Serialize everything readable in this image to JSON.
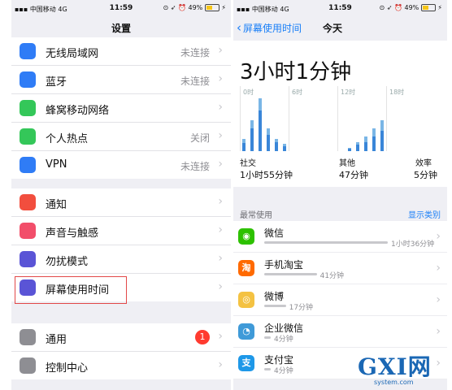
{
  "left_screen": {
    "status": {
      "carrier": "中国移动",
      "network": "4G",
      "time": "11:59",
      "battery": "49%"
    },
    "title": "设置",
    "group1": [
      {
        "icon": "wifi-icon",
        "label": "无线局域网",
        "value": "未连接",
        "color": "#2f7cf6"
      },
      {
        "icon": "bluetooth-icon",
        "label": "蓝牙",
        "value": "未连接",
        "color": "#2f7cf6"
      },
      {
        "icon": "cellular-icon",
        "label": "蜂窝移动网络",
        "value": "",
        "color": "#34c759"
      },
      {
        "icon": "hotspot-icon",
        "label": "个人热点",
        "value": "关闭",
        "color": "#34c759"
      },
      {
        "icon": "vpn-icon",
        "label": "VPN",
        "value": "未连接",
        "color": "#2f7cf6"
      }
    ],
    "group2": [
      {
        "icon": "notifications-icon",
        "label": "通知",
        "color": "#f24e3e"
      },
      {
        "icon": "sound-icon",
        "label": "声音与触感",
        "color": "#f24e6a"
      },
      {
        "icon": "moon-icon",
        "label": "勿扰模式",
        "color": "#5a54d6"
      },
      {
        "icon": "hourglass-icon",
        "label": "屏幕使用时间",
        "color": "#5a54d6"
      }
    ],
    "group3": [
      {
        "icon": "gear-icon",
        "label": "通用",
        "badge": "1",
        "color": "#8e8e93"
      },
      {
        "icon": "control-center-icon",
        "label": "控制中心",
        "color": "#8e8e93"
      }
    ]
  },
  "right_screen": {
    "status": {
      "carrier": "中国移动",
      "network": "4G",
      "time": "11:59",
      "battery": "49%"
    },
    "back_label": "屏幕使用时间",
    "title": "今天",
    "total": "3小时1分钟",
    "hour_labels": [
      "0时",
      "6时",
      "12时",
      "18时"
    ],
    "categories": [
      {
        "name": "社交",
        "value": "1小时55分钟",
        "color": "#3a86d8"
      },
      {
        "name": "其他",
        "value": "47分钟",
        "color": "#7ab6e6"
      },
      {
        "name": "效率",
        "value": "5分钟",
        "color": "#f5a623"
      }
    ],
    "most_used_label": "最常使用",
    "show_categories": "显示类别",
    "apps": [
      {
        "name": "微信",
        "time": "1小时36分钟",
        "usage": 0.8,
        "icon": "wechat-icon",
        "color": "#2dc100"
      },
      {
        "name": "手机淘宝",
        "time": "41分钟",
        "usage": 0.34,
        "icon": "taobao-icon",
        "color": "#ff6a00"
      },
      {
        "name": "微博",
        "time": "17分钟",
        "usage": 0.14,
        "icon": "weibo-icon",
        "color": "#f4c242"
      },
      {
        "name": "企业微信",
        "time": "4分钟",
        "usage": 0.03,
        "icon": "wecom-icon",
        "color": "#3f9ad8"
      },
      {
        "name": "支付宝",
        "time": "4分钟",
        "usage": 0.03,
        "icon": "alipay-icon",
        "color": "#1e98e8"
      }
    ],
    "chart_data": {
      "type": "bar",
      "series": [
        {
          "name": "社交",
          "values": [
            8,
            22,
            40,
            16,
            9,
            5,
            0,
            0,
            0,
            0,
            0,
            0,
            0,
            2,
            6,
            9,
            14,
            20,
            0,
            0,
            0,
            0,
            0,
            0
          ]
        },
        {
          "name": "其他",
          "values": [
            4,
            8,
            12,
            6,
            3,
            2,
            0,
            0,
            0,
            0,
            0,
            0,
            0,
            1,
            3,
            5,
            8,
            10,
            0,
            0,
            0,
            0,
            0,
            0
          ]
        }
      ]
    }
  },
  "watermark": {
    "brand": "GXI网",
    "site": "system.com"
  }
}
